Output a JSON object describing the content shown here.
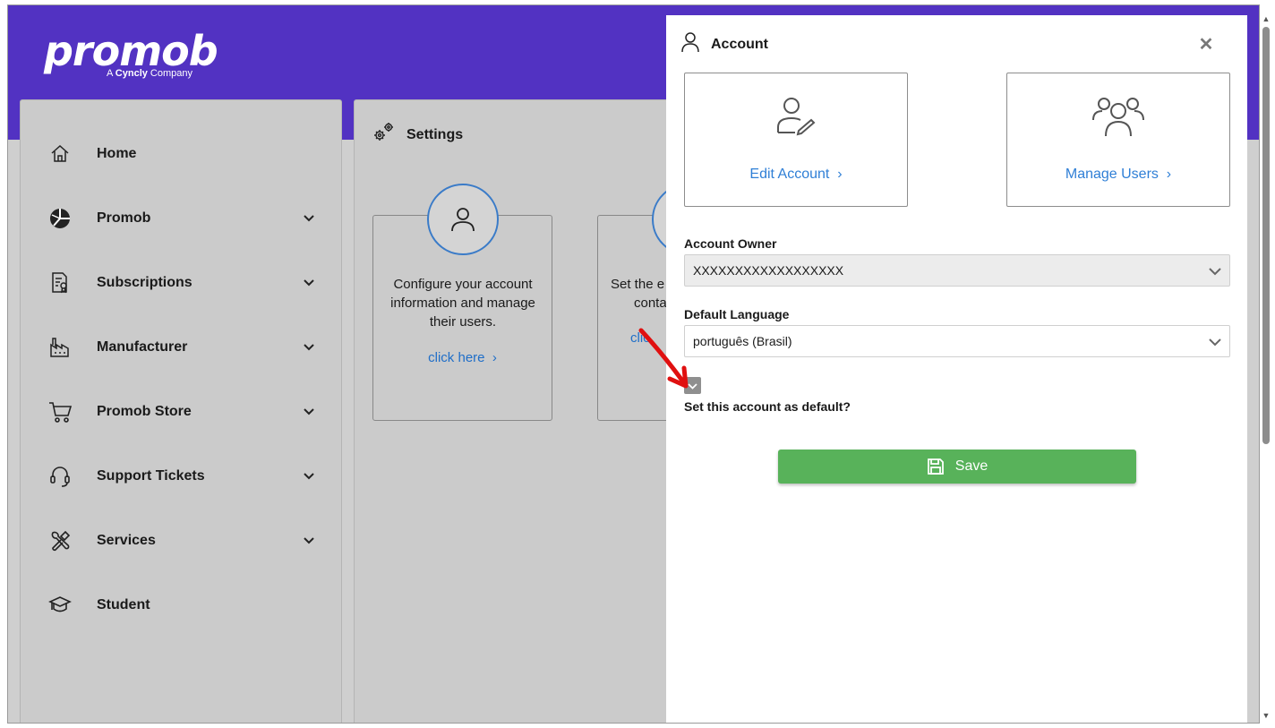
{
  "brand": {
    "logo_text": "promob",
    "tagline_prefix": "A ",
    "tagline_company": "Cyncly",
    "tagline_suffix": " Company"
  },
  "sidebar": {
    "items": [
      {
        "label": "Home",
        "icon": "home-icon",
        "has_chevron": false
      },
      {
        "label": "Promob",
        "icon": "promob-logo-icon",
        "has_chevron": true
      },
      {
        "label": "Subscriptions",
        "icon": "subscription-certificate-icon",
        "has_chevron": true
      },
      {
        "label": "Manufacturer",
        "icon": "factory-icon",
        "has_chevron": true
      },
      {
        "label": "Promob Store",
        "icon": "cart-icon",
        "has_chevron": true
      },
      {
        "label": "Support Tickets",
        "icon": "headset-icon",
        "has_chevron": true
      },
      {
        "label": "Services",
        "icon": "tools-icon",
        "has_chevron": true
      },
      {
        "label": "Student",
        "icon": "graduation-cap-icon",
        "has_chevron": false
      }
    ]
  },
  "settings": {
    "title": "Settings",
    "cards": [
      {
        "text": "Configure your account information and manage their users.",
        "link": "click here"
      },
      {
        "text_partial": "Set the e",
        "text_partial2": "conta",
        "link_partial": "clic"
      }
    ]
  },
  "modal": {
    "title": "Account",
    "tiles": [
      {
        "label": "Edit Account",
        "icon": "user-edit-icon"
      },
      {
        "label": "Manage Users",
        "icon": "users-group-icon"
      }
    ],
    "account_owner": {
      "label": "Account Owner",
      "value": "XXXXXXXXXXXXXXXXXX"
    },
    "default_language": {
      "label": "Default Language",
      "value": "português (Brasil)"
    },
    "default_checkbox": {
      "label": "Set this account as default?",
      "checked": true
    },
    "save_label": "Save"
  },
  "colors": {
    "header": "#5232c2",
    "link": "#2f7fd6",
    "save": "#58b25a",
    "annotation_arrow": "#e01010"
  }
}
